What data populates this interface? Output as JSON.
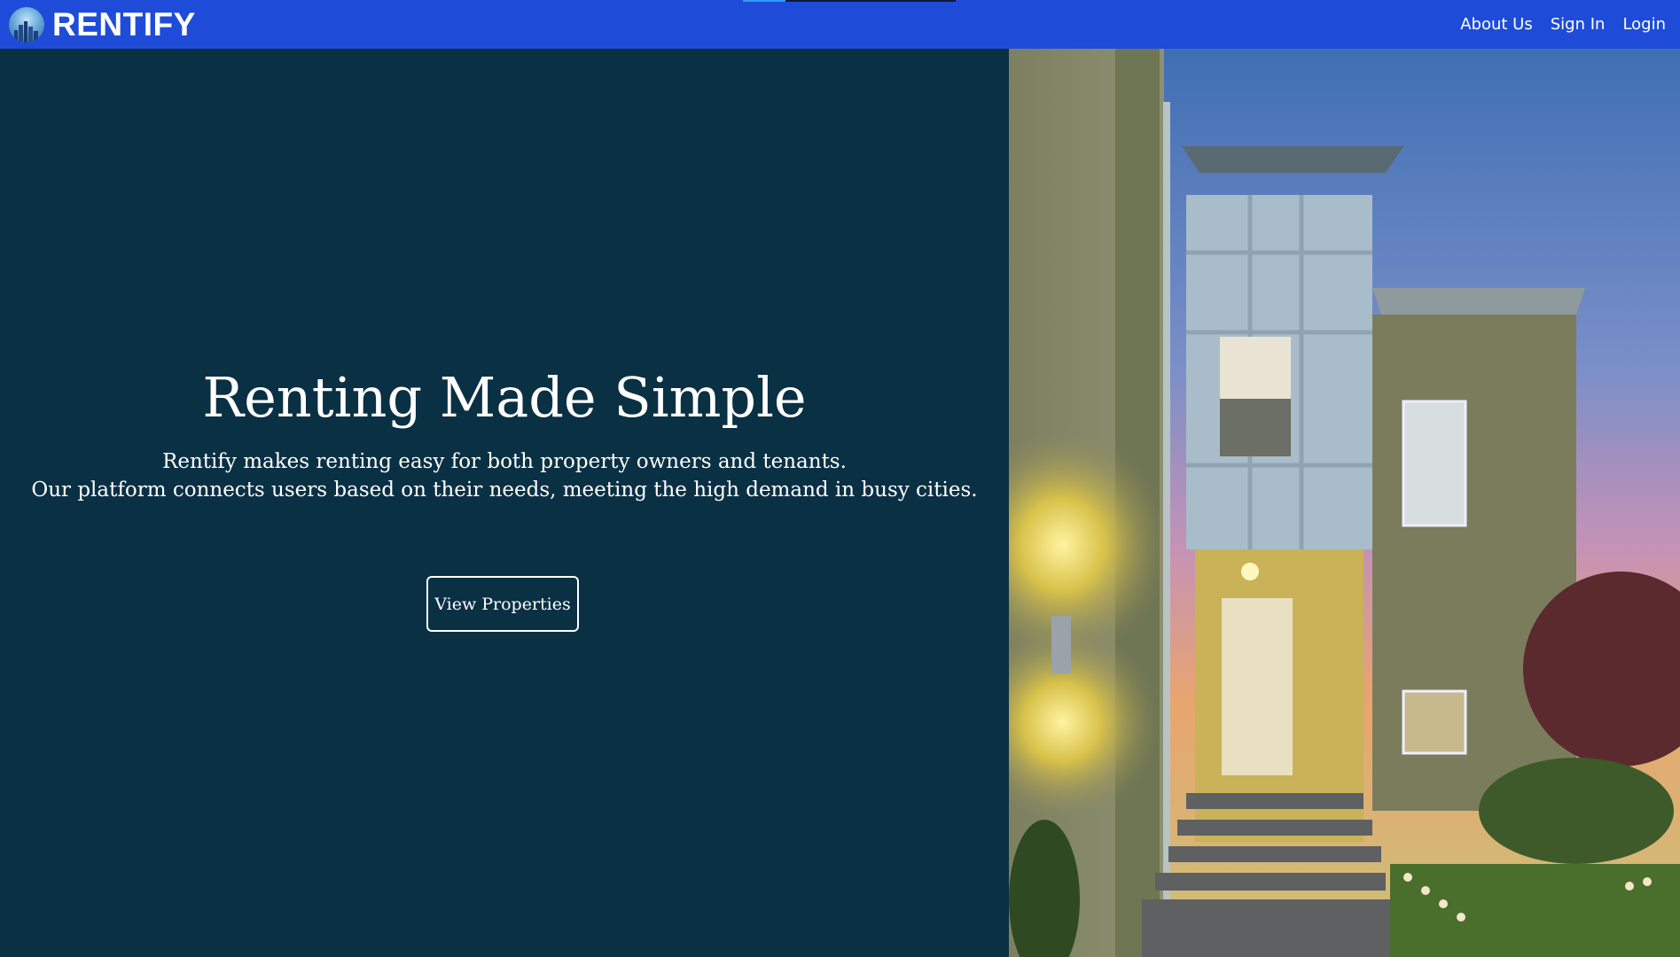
{
  "nav": {
    "brand": "RENTIFY",
    "logo_icon": "city-skyline-icon",
    "links": [
      "About Us",
      "Sign In",
      "Login"
    ],
    "loading_progress": 0.2
  },
  "hero": {
    "title": "Renting Made Simple",
    "subtitle_line1": "Rentify makes renting easy for both property owners and tenants.",
    "subtitle_line2": "Our platform connects users based on their needs, meeting the high demand in busy cities.",
    "cta": "View Properties"
  },
  "colors": {
    "nav_bg": "#1e4cd8",
    "hero_bg": "#0a3044",
    "text": "#ffffff"
  }
}
